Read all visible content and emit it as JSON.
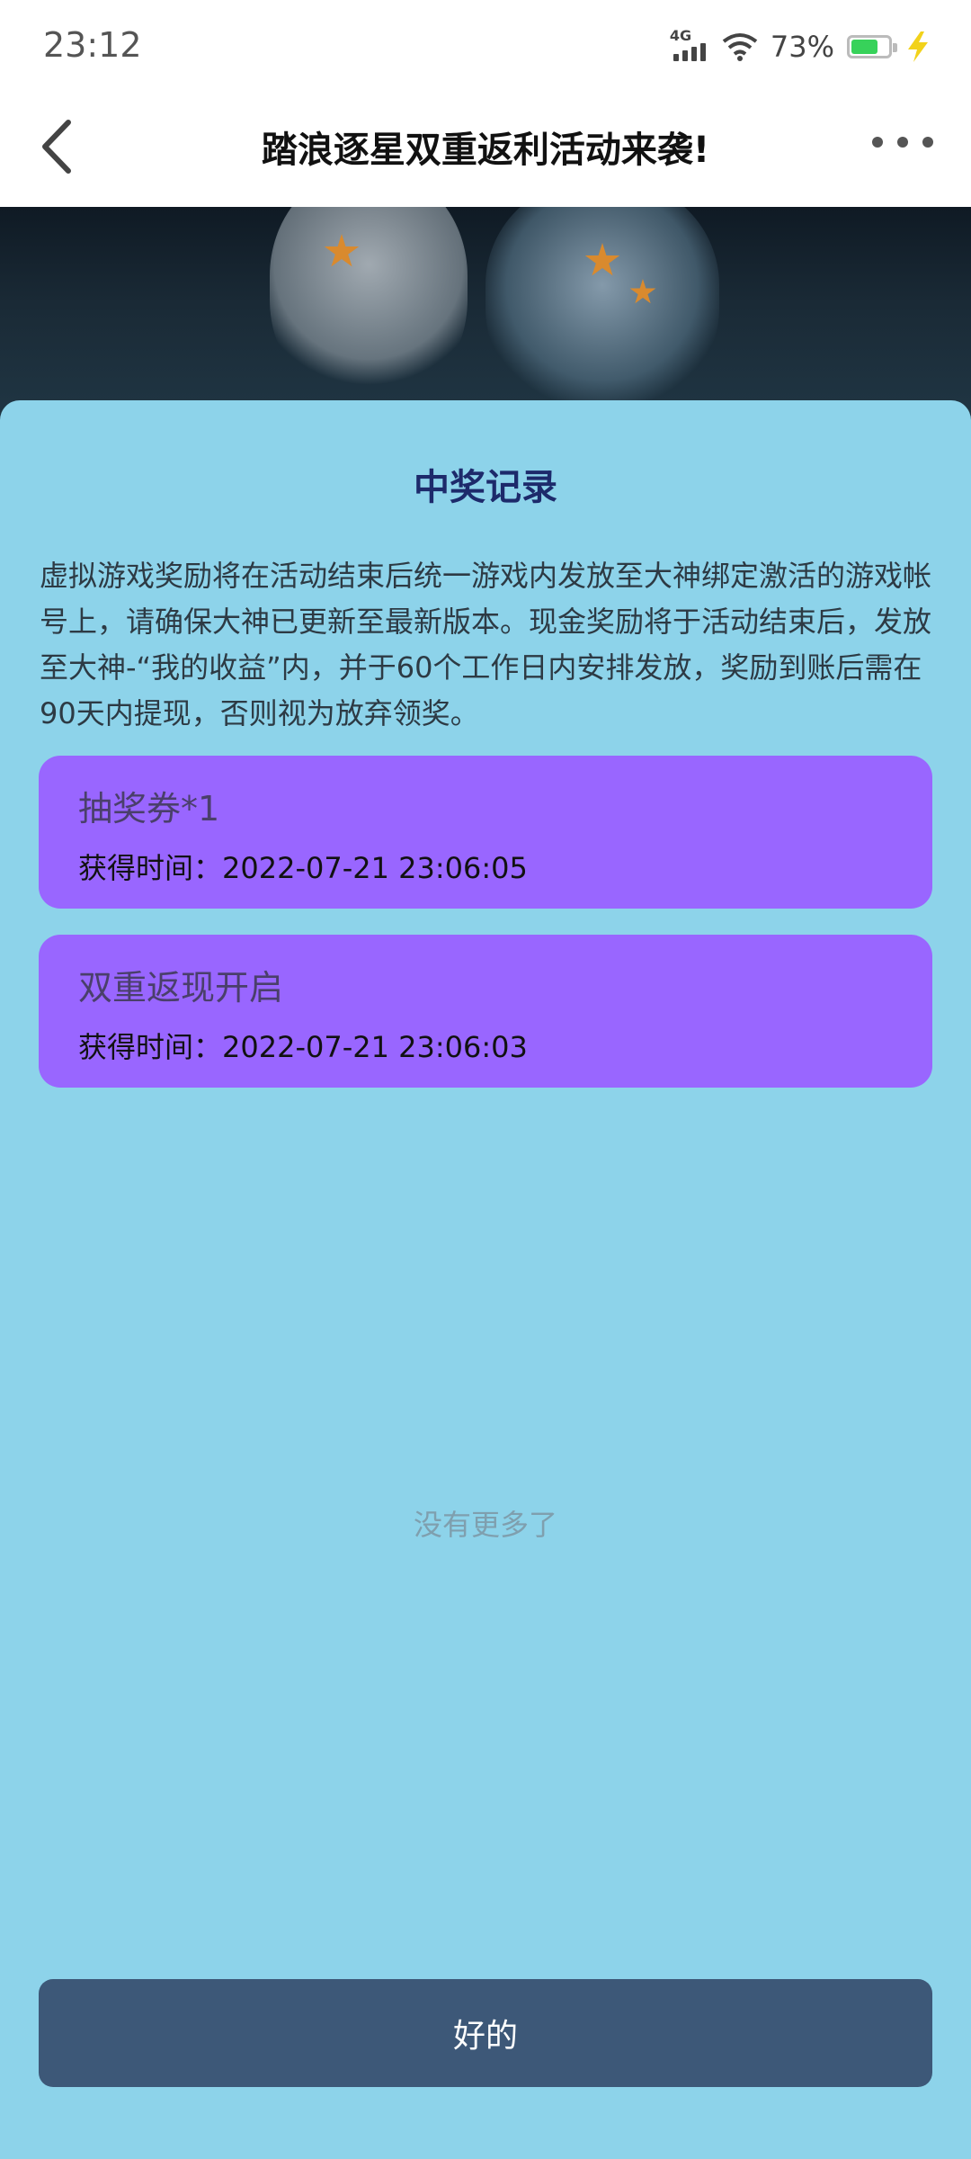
{
  "status_bar": {
    "time": "23:12",
    "network": "4G",
    "battery_percent": "73%",
    "battery_level": 0.73
  },
  "nav": {
    "title": "踏浪逐星双重返利活动来袭!"
  },
  "modal": {
    "title": "中奖记录",
    "description": "虚拟游戏奖励将在活动结束后统一游戏内发放至大神绑定激活的游戏帐号上，请确保大神已更新至最新版本。现金奖励将于活动结束后，发放至大神-“我的收益”内，并于60个工作日内安排发放，奖励到账后需在90天内提现，否则视为放弃领奖。",
    "records": [
      {
        "title": "抽奖券*1",
        "time": "获得时间：2022-07-21 23:06:05"
      },
      {
        "title": "双重返现开启",
        "time": "获得时间：2022-07-21 23:06:03"
      }
    ],
    "no_more": "没有更多了",
    "ok_label": "好的"
  },
  "colors": {
    "modal_bg": "#8dd3ea",
    "card_bg": "#9966ff",
    "button_bg": "#3d5878",
    "title_color": "#1d2a6b"
  },
  "icons": [
    "back-arrow-icon",
    "more-dots-icon",
    "signal-icon",
    "wifi-icon",
    "battery-icon",
    "charging-bolt-icon"
  ]
}
